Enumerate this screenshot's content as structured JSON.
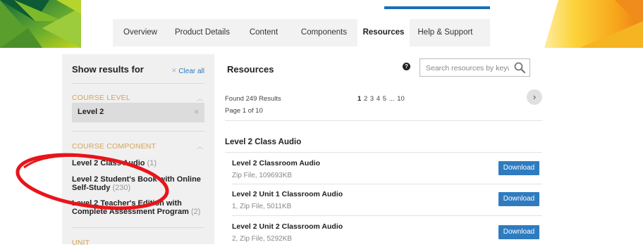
{
  "tabs": [
    {
      "label": "Overview"
    },
    {
      "label": "Product Details"
    },
    {
      "label": "Content"
    },
    {
      "label": "Components"
    },
    {
      "label": "Resources"
    },
    {
      "label": "Help & Support"
    }
  ],
  "sidebar": {
    "title": "Show results for",
    "clear_all": "Clear all",
    "course_level": {
      "heading": "COURSE LEVEL",
      "selected": "Level 2"
    },
    "course_component": {
      "heading": "COURSE COMPONENT",
      "items": [
        {
          "label": "Level 2 Class Audio",
          "count": "(1)"
        },
        {
          "label": "Level 2 Student's Book with Online Self-Study",
          "count": "(230)"
        },
        {
          "label": "Level 2 Teacher's Edition with Complete Assessment Program",
          "count": "(2)"
        }
      ]
    },
    "unit": {
      "heading": "UNIT"
    }
  },
  "resources": {
    "title": "Resources",
    "search_placeholder": "Search resources by keyword",
    "found": "Found 249 Results",
    "page_of": "Page 1 of 10",
    "pager": {
      "current": "1",
      "pages": [
        "2",
        "3",
        "4",
        "5"
      ],
      "ellipsis": "...",
      "last": "10"
    },
    "category": "Level 2 Class Audio",
    "download_label": "Download",
    "rows": [
      {
        "title": "Level 2 Classroom Audio",
        "subtitle": "Zip File, 109693KB"
      },
      {
        "title": "Level 2 Unit 1 Classroom Audio",
        "subtitle": "1, Zip File, 5011KB"
      },
      {
        "title": "Level 2 Unit 2 Classroom Audio",
        "subtitle": "2, Zip File, 5292KB"
      }
    ]
  },
  "colors": {
    "accent_blue": "#2f7bbf",
    "tab_bar": "#1e6fb5",
    "section_heading": "#d4a35a",
    "annotation_red": "#e8141b"
  },
  "icons": [
    "help-icon",
    "search-icon",
    "close-icon",
    "chevron-up-icon",
    "chevron-right-icon"
  ]
}
